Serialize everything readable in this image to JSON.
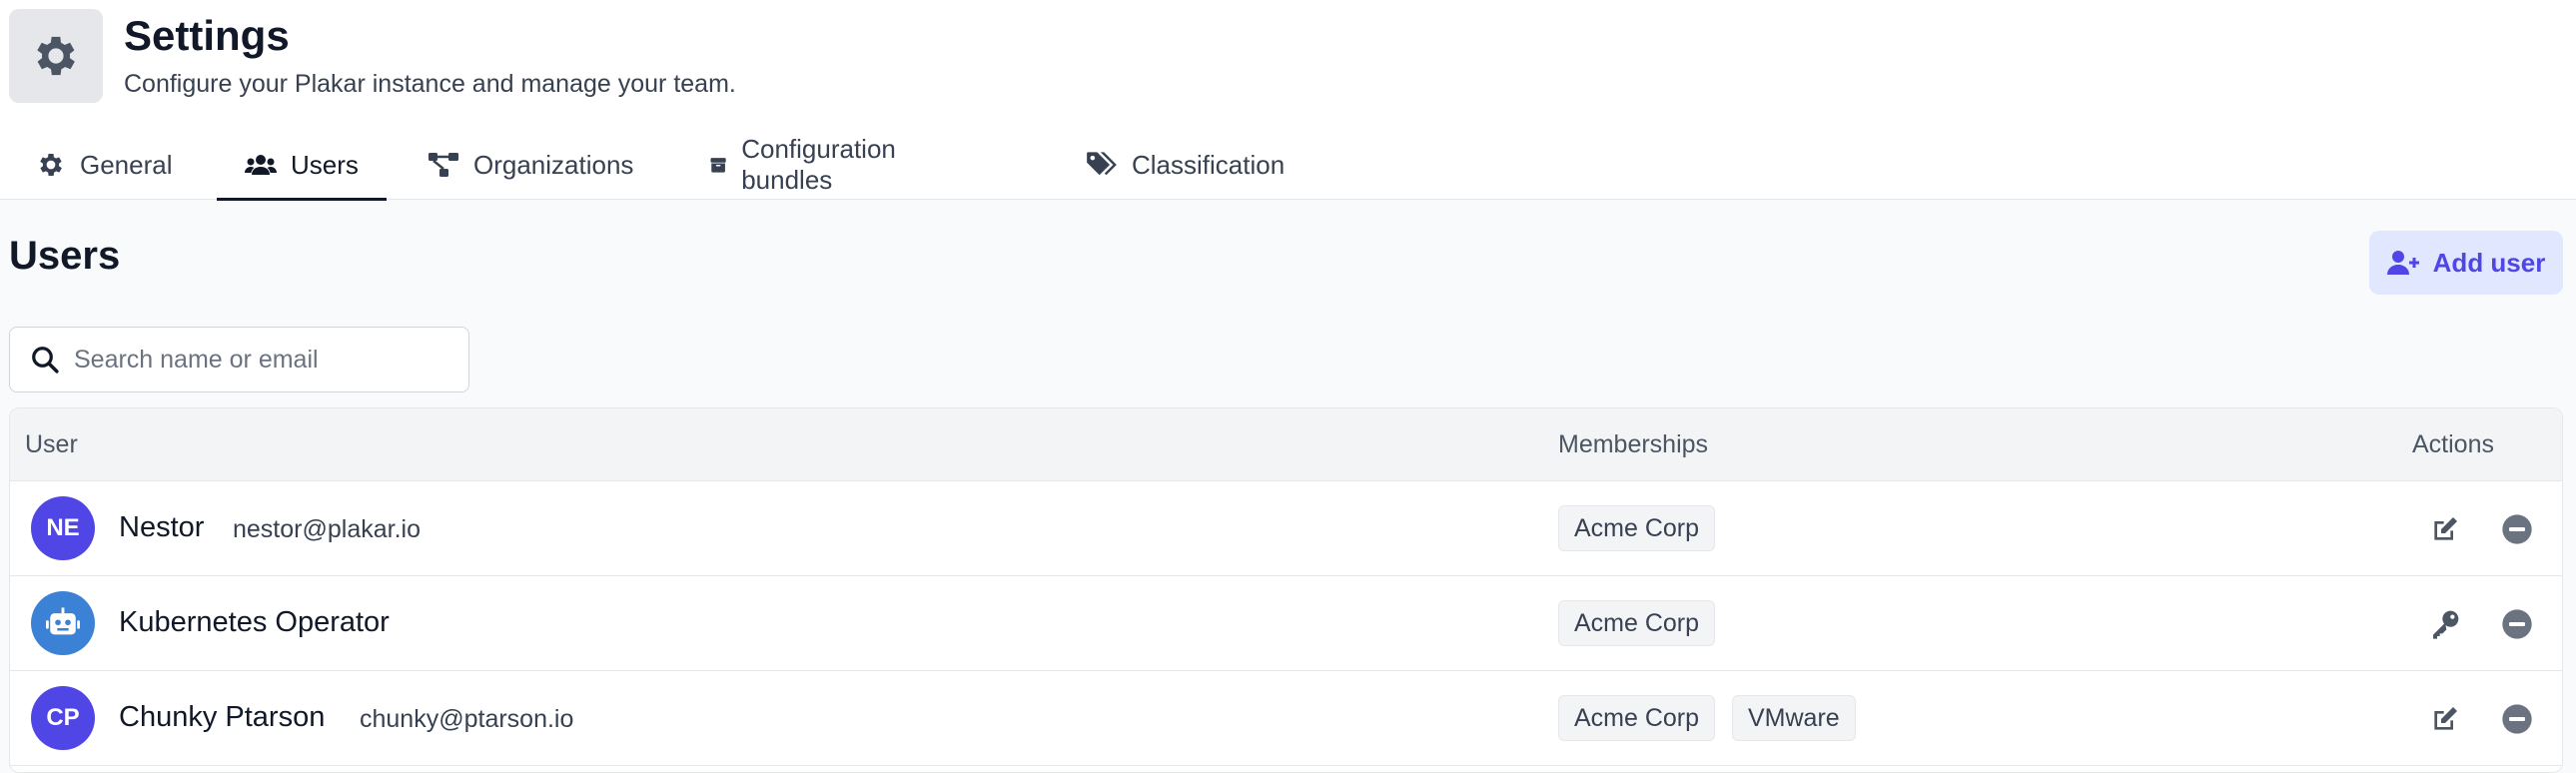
{
  "header": {
    "title": "Settings",
    "subtitle": "Configure your Plakar instance and manage your team."
  },
  "tabs": [
    {
      "label": "General",
      "icon": "gear-icon"
    },
    {
      "label": "Users",
      "icon": "users-icon",
      "active": true
    },
    {
      "label": "Organizations",
      "icon": "sitemap-icon"
    },
    {
      "label": "Configuration bundles",
      "icon": "box-icon"
    },
    {
      "label": "Classification",
      "icon": "tags-icon"
    }
  ],
  "users_section": {
    "title": "Users",
    "add_user_label": "Add user",
    "search_placeholder": "Search name or email"
  },
  "table": {
    "columns": [
      "User",
      "Memberships",
      "Actions"
    ],
    "rows": [
      {
        "initials": "NE",
        "name": "Nestor",
        "email": "nestor@plakar.io",
        "memberships": [
          "Acme Corp"
        ],
        "actions": [
          "edit-icon",
          "remove-icon"
        ]
      },
      {
        "initials": "",
        "avatar_icon": "robot-icon",
        "name": "Kubernetes Operator",
        "email": "",
        "memberships": [
          "Acme Corp"
        ],
        "actions": [
          "key-icon",
          "remove-icon"
        ]
      },
      {
        "initials": "CP",
        "name": "Chunky Ptarson",
        "email": "chunky@ptarson.io",
        "memberships": [
          "Acme Corp",
          "VMware"
        ],
        "actions": [
          "edit-icon",
          "remove-icon"
        ]
      }
    ]
  },
  "colors": {
    "accent": "#4f46e5",
    "accent_bg": "#e0e7ff",
    "bot_avatar": "#3b82d6"
  }
}
